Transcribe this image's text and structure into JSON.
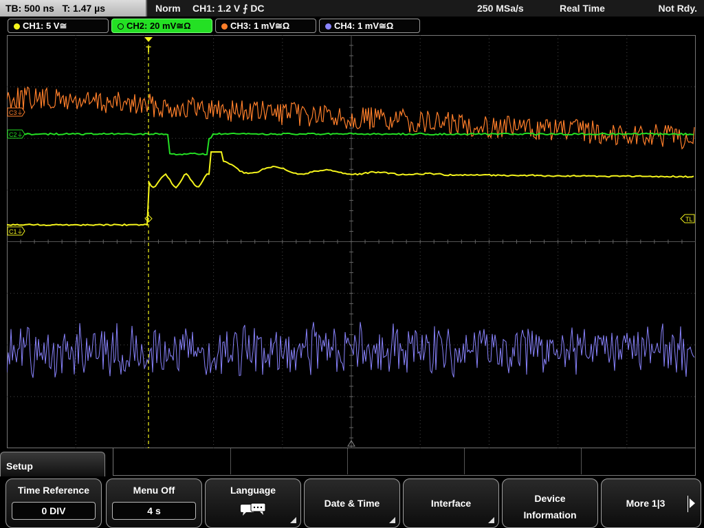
{
  "status": {
    "timebase": "TB: 500 ns   T: 1.47 µs",
    "mode": "Norm",
    "trigger": "CH1: 1.2 V ⨍ DC",
    "sample_rate": "250 MSa/s",
    "acquisition": "Real Time",
    "ready": "Not Rdy."
  },
  "channels": [
    {
      "label": "CH1: 5 V≅",
      "color": "#f5f51c"
    },
    {
      "label": "CH2: 20 mV≅Ω",
      "color": "#24e024"
    },
    {
      "label": "CH3: 1 mV≅Ω",
      "color": "#ff7f2a"
    },
    {
      "label": "CH4: 1 mV≅Ω",
      "color": "#8a84ff"
    }
  ],
  "markers": {
    "c3": "C3⏚",
    "c2": "C2⏚",
    "c1": "C1⏚",
    "trigger_level": "TL",
    "trigger_pos": "T"
  },
  "colors": {
    "ch1": "#f5f51c",
    "ch2": "#24e024",
    "ch3": "#ff7f2a",
    "ch4": "#8a84ff",
    "grid": "#4a4a4a"
  },
  "menu": {
    "title": "Setup",
    "softkeys": {
      "time_reference": {
        "label": "Time Reference",
        "value": "0 DIV"
      },
      "menu_off": {
        "label": "Menu Off",
        "value": "4 s"
      },
      "language": {
        "label": "Language",
        "icon": "speech-bubbles-icon"
      },
      "date_time": {
        "label": "Date & Time"
      },
      "interface": {
        "label": "Interface"
      },
      "device_info": {
        "label_line1": "Device",
        "label_line2": "Information"
      },
      "more": {
        "label": "More 1|3"
      }
    }
  }
}
